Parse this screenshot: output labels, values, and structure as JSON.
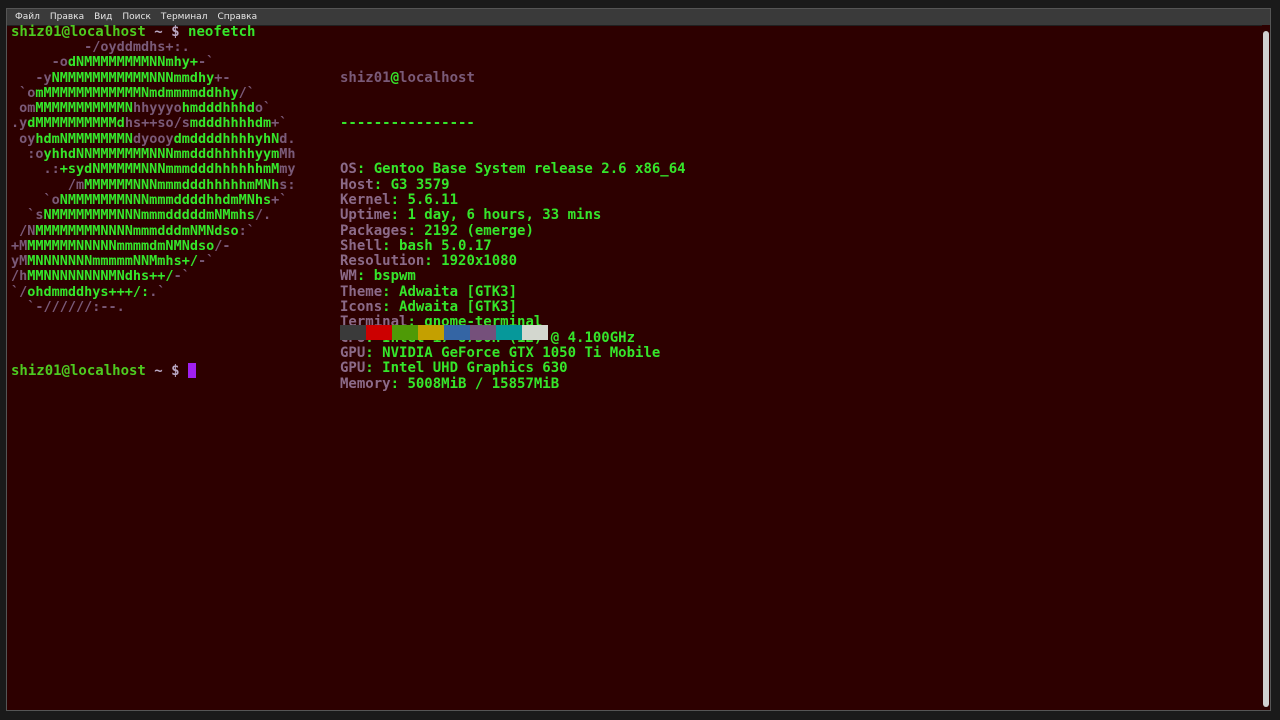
{
  "menu": [
    "Файл",
    "Правка",
    "Вид",
    "Поиск",
    "Терминал",
    "Справка"
  ],
  "prompt": {
    "user": "shiz01@localhost",
    "path": "~",
    "symbol": "$",
    "command": "neofetch"
  },
  "art": [
    [
      [
        "p",
        "         -/oyddmdhs+:."
      ]
    ],
    [
      [
        "p",
        "     -o"
      ],
      [
        "g",
        "dNMMMMMMMMNNmhy+"
      ],
      [
        "p",
        "-`"
      ]
    ],
    [
      [
        "p",
        "   -y"
      ],
      [
        "g",
        "NMMMMMMMMMMMNNNmmdhy"
      ],
      [
        "p",
        "+-"
      ]
    ],
    [
      [
        "p",
        " `o"
      ],
      [
        "g",
        "mMMMMMMMMMMMMNmdmmmmddhhy"
      ],
      [
        "p",
        "/`"
      ]
    ],
    [
      [
        "p",
        " om"
      ],
      [
        "g",
        "MMMMMMMMMMMN"
      ],
      [
        "p",
        "hhyyyo"
      ],
      [
        "g",
        "hmdddhhhd"
      ],
      [
        "p",
        "o`"
      ]
    ],
    [
      [
        "p",
        ".y"
      ],
      [
        "g",
        "dMMMMMMMMMMd"
      ],
      [
        "p",
        "hs++so/s"
      ],
      [
        "g",
        "mdddhhhhdm"
      ],
      [
        "p",
        "+`"
      ]
    ],
    [
      [
        "p",
        " oy"
      ],
      [
        "g",
        "hdmNMMMMMMMN"
      ],
      [
        "p",
        "dyooy"
      ],
      [
        "g",
        "dmddddhhhhyhN"
      ],
      [
        "p",
        "d."
      ]
    ],
    [
      [
        "p",
        "  :o"
      ],
      [
        "g",
        "yhhdNNMMMMMMMNNNmmdddhhhhhyym"
      ],
      [
        "p",
        "Mh"
      ]
    ],
    [
      [
        "p",
        "    .:"
      ],
      [
        "g",
        "+sydNMMMMMNNNmmmdddhhhhhhmM"
      ],
      [
        "p",
        "my"
      ]
    ],
    [
      [
        "p",
        "       /m"
      ],
      [
        "g",
        "MMMMMMNNNmmmdddhhhhhmMNh"
      ],
      [
        "p",
        "s:"
      ]
    ],
    [
      [
        "p",
        "    `o"
      ],
      [
        "g",
        "NMMMMMMMNNNmmmddddhhdmMNhs"
      ],
      [
        "p",
        "+`"
      ]
    ],
    [
      [
        "p",
        "  `s"
      ],
      [
        "g",
        "NMMMMMMMMNNNmmmdddddmNMmhs"
      ],
      [
        "p",
        "/."
      ]
    ],
    [
      [
        "p",
        " /N"
      ],
      [
        "g",
        "MMMMMMMMNNNNmmmdddmNMNdso"
      ],
      [
        "p",
        ":`"
      ]
    ],
    [
      [
        "p",
        "+M"
      ],
      [
        "g",
        "MMMMMMNNNNNmmmmdmNMNdso"
      ],
      [
        "p",
        "/-"
      ]
    ],
    [
      [
        "p",
        "yM"
      ],
      [
        "g",
        "MNNNNNNNmmmmmNNMmhs+/"
      ],
      [
        "p",
        "-`"
      ]
    ],
    [
      [
        "p",
        "/h"
      ],
      [
        "g",
        "MMNNNNNNNNMNdhs++/"
      ],
      [
        "p",
        "-`"
      ]
    ],
    [
      [
        "p",
        "`/"
      ],
      [
        "g",
        "ohdmmddhys+++/:"
      ],
      [
        "p",
        ".`"
      ]
    ],
    [
      [
        "p",
        "  `-//////:--."
      ]
    ]
  ],
  "info": {
    "title_user": "shiz01",
    "title_at": "@",
    "title_host": "localhost",
    "separator": "----------------",
    "rows": [
      [
        "OS",
        "Gentoo Base System release 2.6 x86_64"
      ],
      [
        "Host",
        "G3 3579"
      ],
      [
        "Kernel",
        "5.6.11"
      ],
      [
        "Uptime",
        "1 day, 6 hours, 33 mins"
      ],
      [
        "Packages",
        "2192 (emerge)"
      ],
      [
        "Shell",
        "bash 5.0.17"
      ],
      [
        "Resolution",
        "1920x1080"
      ],
      [
        "WM",
        "bspwm"
      ],
      [
        "Theme",
        "Adwaita [GTK3]"
      ],
      [
        "Icons",
        "Adwaita [GTK3]"
      ],
      [
        "Terminal",
        "gnome-terminal"
      ],
      [
        "CPU",
        "Intel i7-8750H (12) @ 4.100GHz"
      ],
      [
        "GPU",
        "NVIDIA GeForce GTX 1050 Ti Mobile"
      ],
      [
        "GPU",
        "Intel UHD Graphics 630"
      ],
      [
        "Memory",
        "5008MiB / 15857MiB"
      ]
    ]
  },
  "swatches": [
    "#3a3a3a",
    "#cc0000",
    "#4e9a06",
    "#c4a000",
    "#3465a4",
    "#75507b",
    "#06989a",
    "#d3d7cf"
  ]
}
